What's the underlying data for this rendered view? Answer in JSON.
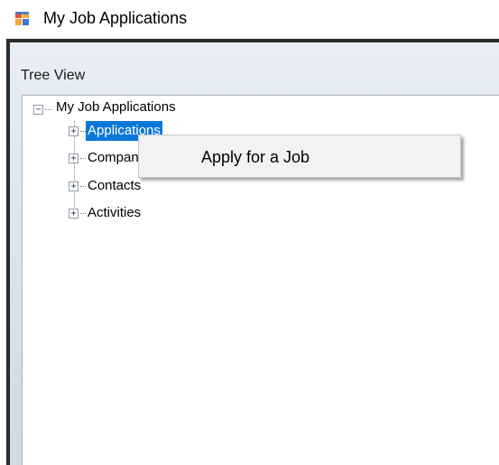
{
  "window": {
    "title": "My Job Applications",
    "app_icon": "app-form-icon"
  },
  "group": {
    "label": "Tree View"
  },
  "tree": {
    "root": {
      "label": "My Job Applications",
      "expanded": true,
      "expander_symbol": "−"
    },
    "children": [
      {
        "label": "Applications",
        "expander_symbol": "+",
        "selected": true
      },
      {
        "label": "Companies",
        "expander_symbol": "+",
        "selected": false
      },
      {
        "label": "Contacts",
        "expander_symbol": "+",
        "selected": false
      },
      {
        "label": "Activities",
        "expander_symbol": "+",
        "selected": false
      }
    ]
  },
  "context_menu": {
    "items": [
      {
        "label": "Apply for a Job"
      }
    ]
  },
  "colors": {
    "selection": "#0a78d7",
    "menu_background": "#f2f2f2",
    "group_gradient_top": "#e9eef6",
    "group_gradient_bottom": "#cfd9e8"
  }
}
